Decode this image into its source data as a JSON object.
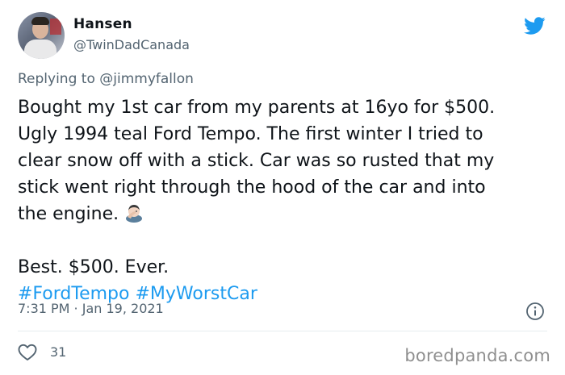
{
  "author": {
    "display_name": "Hansen",
    "handle": "@TwinDadCanada",
    "avatar_icon": "profile-photo"
  },
  "brand": {
    "logo_icon": "twitter-bird-icon",
    "accent_color": "#1d9bf0"
  },
  "reply_context": {
    "prefix": "Replying to",
    "mention": "@jimmyfallon"
  },
  "tweet": {
    "lines": [
      "Bought my 1st car from my parents at 16yo for $500.",
      "Ugly 1994 teal Ford Tempo. The first winter I tried to",
      "clear snow off with a stick. Car was so rusted that my",
      "stick went right through the hood of the car and into",
      "the engine."
    ],
    "emoji_icon": "man-facepalming-emoji",
    "closing_line": "Best. $500. Ever.",
    "hashtags": [
      "#FordTempo",
      "#MyWorstCar"
    ]
  },
  "meta": {
    "timestamp": "7:31 PM · Jan 19, 2021",
    "info_icon": "info-icon"
  },
  "actions": {
    "like_icon": "heart-icon",
    "like_count": "31"
  },
  "watermark": "boredpanda.com"
}
